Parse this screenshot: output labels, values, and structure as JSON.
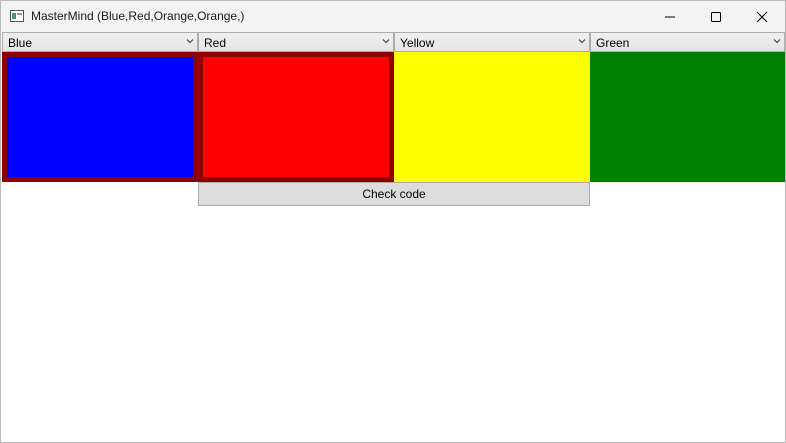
{
  "window": {
    "title": "MasterMind (Blue,Red,Orange,Orange,)"
  },
  "combos": [
    {
      "label": "Blue"
    },
    {
      "label": "Red"
    },
    {
      "label": "Yellow"
    },
    {
      "label": "Green"
    }
  ],
  "pegs": [
    {
      "color": "#0000ff",
      "selected": true
    },
    {
      "color": "#ff0000",
      "selected": true
    },
    {
      "color": "#ffff00",
      "selected": false
    },
    {
      "color": "#008000",
      "selected": false
    }
  ],
  "selection_border_color": "#8b0000",
  "check_button": {
    "label": "Check code"
  }
}
